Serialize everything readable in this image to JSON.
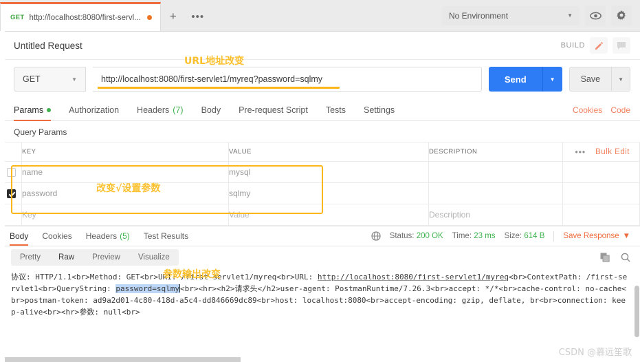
{
  "tabstrip": {
    "request_tab": {
      "method": "GET",
      "url": "http://localhost:8080/first-servl...",
      "unsaved": true
    },
    "new_tab_label": "+",
    "more_label": "•••",
    "environment": "No Environment",
    "env_caret": "▼",
    "eye_icon": "eye-icon",
    "gear_icon": "gear-icon"
  },
  "request_header": {
    "title": "Untitled Request",
    "build_label": "BUILD",
    "edit_icon": "pencil-icon",
    "comment_icon": "comment-icon"
  },
  "url_bar": {
    "method": "GET",
    "method_caret": "▼",
    "url": "http://localhost:8080/first-servlet1/myreq?password=sqlmy",
    "send_label": "Send",
    "send_caret": "▼",
    "save_label": "Save",
    "save_caret": "▼"
  },
  "request_tabs": {
    "items": [
      {
        "label": "Params",
        "dot": true,
        "active": true
      },
      {
        "label": "Authorization",
        "dot": false,
        "active": false
      },
      {
        "label": "Headers",
        "count": "(7)",
        "active": false
      },
      {
        "label": "Body",
        "active": false
      },
      {
        "label": "Pre-request Script",
        "active": false
      },
      {
        "label": "Tests",
        "active": false
      },
      {
        "label": "Settings",
        "active": false
      }
    ],
    "cookies_link": "Cookies",
    "code_link": "Code"
  },
  "query_params": {
    "section_label": "Query Params",
    "columns": [
      "KEY",
      "VALUE",
      "DESCRIPTION"
    ],
    "dots_label": "•••",
    "bulk_edit_label": "Bulk Edit",
    "rows": [
      {
        "checked": false,
        "key": "name",
        "value": "mysql",
        "description": "",
        "placeholder": false
      },
      {
        "checked": true,
        "key": "password",
        "value": "sqlmy",
        "description": "",
        "placeholder": false
      },
      {
        "checked": false,
        "key": "Key",
        "value": "Value",
        "description": "Description",
        "placeholder": true
      }
    ]
  },
  "response": {
    "tabs": [
      {
        "label": "Body",
        "active": true
      },
      {
        "label": "Cookies",
        "active": false
      },
      {
        "label": "Headers",
        "count": "(5)",
        "active": false
      },
      {
        "label": "Test Results",
        "active": false
      }
    ],
    "globe_icon": "globe-icon",
    "status_label": "Status:",
    "status_value": "200 OK",
    "time_label": "Time:",
    "time_value": "23 ms",
    "size_label": "Size:",
    "size_value": "614 B",
    "save_response_label": "Save Response",
    "save_response_caret": "▼",
    "view_modes": [
      {
        "label": "Pretty",
        "active": false
      },
      {
        "label": "Raw",
        "active": true
      },
      {
        "label": "Preview",
        "active": false
      },
      {
        "label": "Visualize",
        "active": false
      }
    ],
    "copy_icon": "copy-icon",
    "search_icon": "search-icon",
    "body": {
      "seg_1": "协议: HTTP/1.1<br>Method: GET<br>URI: /first-servlet1/myreq<br>URL: ",
      "seg_url": "http://localhost:8080/first-servlet1/myreq",
      "seg_2": "<br>ContextPath: /first-servlet1<br>QueryString: ",
      "seg_selected": "password=sqlmy",
      "seg_3": "<br><hr><h2>请求头</h2>user-agent: PostmanRuntime/7.26.3<br>accept: */*<br>cache-control: no-cache<br>postman-token: ad9a2d01-4c80-418d-a5c4-dd846669dc89<br>host: localhost:8080<br>accept-encoding: gzip, deflate, br<br>connection: keep-alive<br><hr>参数: null<br>"
    }
  },
  "annotations": {
    "url_changed": "URL地址改变",
    "params_changed": "改变√设置参数",
    "output_changed": "参数输出改变"
  },
  "watermark": "CSDN @慕远笙歌",
  "colors": {
    "accent_orange": "#ef6c3e",
    "send_blue": "#2e7bf6",
    "status_green": "#3fb34f",
    "annotation_yellow": "#fbc02d",
    "highlight_border": "#fbb71a"
  }
}
